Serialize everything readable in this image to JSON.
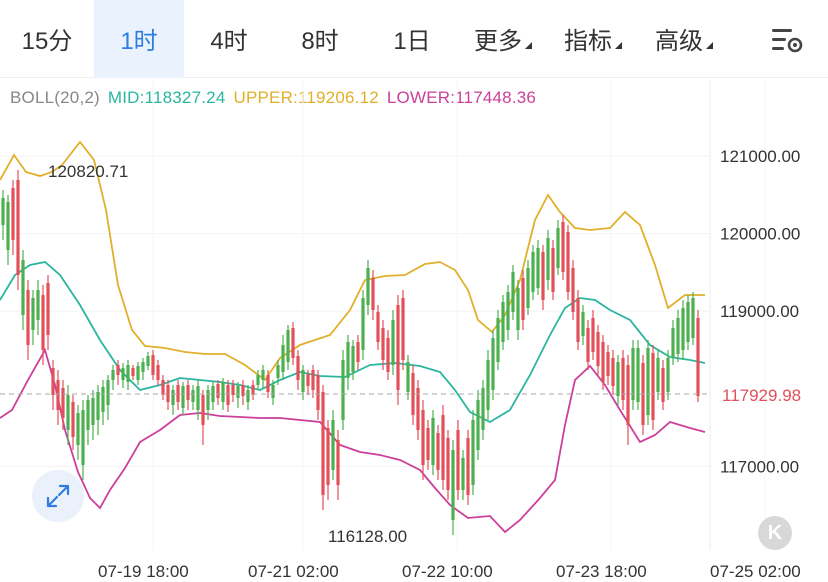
{
  "tabs": [
    {
      "label": "15分",
      "active": false,
      "dropdown": false
    },
    {
      "label": "1时",
      "active": true,
      "dropdown": false
    },
    {
      "label": "4时",
      "active": false,
      "dropdown": false
    },
    {
      "label": "8时",
      "active": false,
      "dropdown": false
    },
    {
      "label": "1日",
      "active": false,
      "dropdown": false
    },
    {
      "label": "更多",
      "active": false,
      "dropdown": true
    },
    {
      "label": "指标",
      "active": false,
      "dropdown": true
    },
    {
      "label": "高级",
      "active": false,
      "dropdown": true
    }
  ],
  "settings_icon": "chart-settings-icon",
  "legend": {
    "indicator": "BOLL(20,2)",
    "mid": "MID:118327.24",
    "upper": "UPPER:119206.12",
    "lower": "LOWER:117448.36"
  },
  "colors": {
    "accent": "#2f7de1",
    "mid": "#2bb5a0",
    "upper": "#e0b02a",
    "lower": "#cc3f9a",
    "up_candle": "#4caf50",
    "down_candle": "#e2505a",
    "current_price": "#e2505a"
  },
  "price_axis": {
    "ticks": [
      "121000.00",
      "120000.00",
      "119000.00",
      "117000.00"
    ],
    "current_price": "117929.98"
  },
  "time_axis": [
    "07-19 18:00",
    "07-21 02:00",
    "07-22 10:00",
    "07-23 18:00",
    "07-25 02:00"
  ],
  "annotations": {
    "high": "120820.71",
    "low": "116128.00"
  },
  "buttons": {
    "expand_icon": "expand-icon",
    "k_label": "K"
  }
}
